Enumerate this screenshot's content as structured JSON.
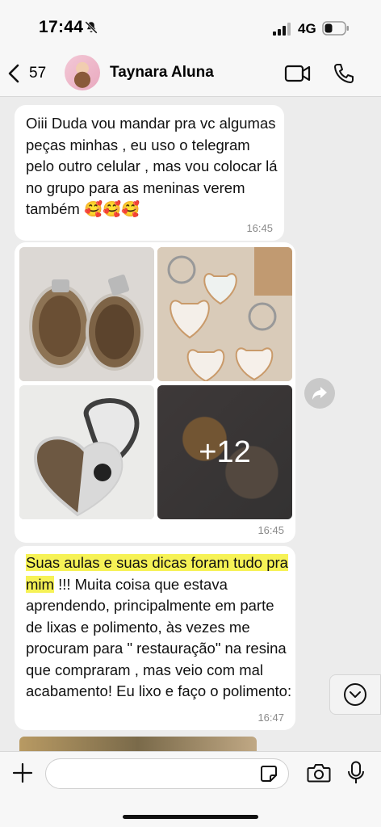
{
  "status_bar": {
    "time": "17:44",
    "network": "4G"
  },
  "header": {
    "back_count": "57",
    "contact_name": "Taynara Aluna"
  },
  "messages": [
    {
      "text": "Oiii Duda vou mandar pra vc algumas peças minhas , eu uso o telegram pelo outro celular , mas vou colocar lá no grupo para as meninas verem também 🥰🥰🥰",
      "time": "16:45"
    },
    {
      "album_more": "+12",
      "time": "16:45"
    },
    {
      "highlighted_text": "Suas aulas e suas dicas foram tudo pra mim",
      "text": " !!! Muita coisa que estava aprendendo, principalmente em parte de lixas e polimento, às vezes me procuram para \" restauração\" na resina que compraram , mas veio com mal acabamento! Eu lixo e faço o polimento:",
      "time": "16:47"
    }
  ],
  "input": {
    "placeholder": ""
  },
  "colors": {
    "highlight": "#f6f256",
    "chat_background": "#ececec",
    "bubble": "#ffffff"
  },
  "icons": [
    "bell-off-icon",
    "signal-icon",
    "battery-icon",
    "back-chevron-icon",
    "video-icon",
    "phone-icon",
    "forward-icon",
    "chevron-down-icon",
    "plus-icon",
    "sticker-icon",
    "camera-icon",
    "mic-icon"
  ]
}
